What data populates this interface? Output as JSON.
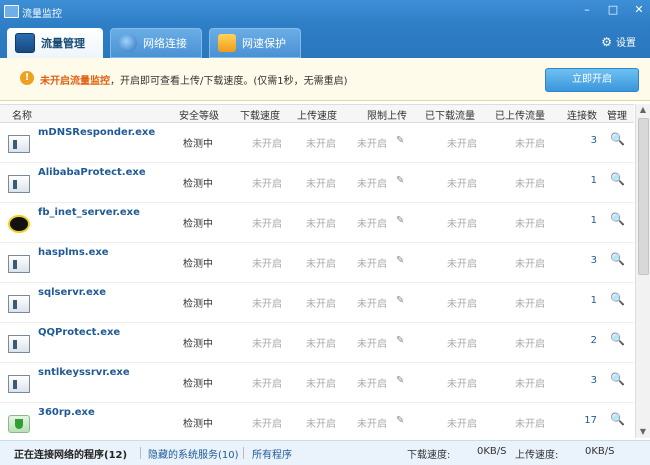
{
  "window": {
    "title": "流量监控",
    "min": "–",
    "max": "□",
    "close": "✕"
  },
  "tabs": [
    {
      "label": "流量管理",
      "active": true
    },
    {
      "label": "网络连接",
      "active": false
    },
    {
      "label": "网速保护",
      "active": false
    }
  ],
  "settings_label": "设置",
  "notice": {
    "icon": "!",
    "highlight": "未开启流量监控",
    "text": "，开启即可查看上传/下载速度。(仅需1秒，无需重启)",
    "button": "立即开启"
  },
  "columns": {
    "name": "名称",
    "security": "安全等级",
    "download_speed": "下载速度",
    "upload_speed": "上传速度",
    "upload_limit": "限制上传",
    "downloaded": "已下载流量",
    "uploaded": "已上传流量",
    "connections": "连接数",
    "manage": "管理"
  },
  "rows": [
    {
      "name": "mDNSResponder.exe",
      "icon": "program-icon",
      "security": "检测中",
      "download": "未开启",
      "upload": "未开启",
      "limit": "未开启",
      "downloaded": "未开启",
      "uploaded": "未开启",
      "connections": "3"
    },
    {
      "name": "AlibabaProtect.exe",
      "icon": "program-icon",
      "security": "检测中",
      "download": "未开启",
      "upload": "未开启",
      "limit": "未开启",
      "downloaded": "未开启",
      "uploaded": "未开启",
      "connections": "1"
    },
    {
      "name": "fb_inet_server.exe",
      "icon": "firebird-icon",
      "security": "检测中",
      "download": "未开启",
      "upload": "未开启",
      "limit": "未开启",
      "downloaded": "未开启",
      "uploaded": "未开启",
      "connections": "1"
    },
    {
      "name": "hasplms.exe",
      "icon": "program-icon",
      "security": "检测中",
      "download": "未开启",
      "upload": "未开启",
      "limit": "未开启",
      "downloaded": "未开启",
      "uploaded": "未开启",
      "connections": "3"
    },
    {
      "name": "sqlservr.exe",
      "icon": "program-icon",
      "security": "检测中",
      "download": "未开启",
      "upload": "未开启",
      "limit": "未开启",
      "downloaded": "未开启",
      "uploaded": "未开启",
      "connections": "1"
    },
    {
      "name": "QQProtect.exe",
      "icon": "program-icon",
      "security": "检测中",
      "download": "未开启",
      "upload": "未开启",
      "limit": "未开启",
      "downloaded": "未开启",
      "uploaded": "未开启",
      "connections": "2"
    },
    {
      "name": "sntlkeyssrvr.exe",
      "icon": "program-icon",
      "security": "检测中",
      "download": "未开启",
      "upload": "未开启",
      "limit": "未开启",
      "downloaded": "未开启",
      "uploaded": "未开启",
      "connections": "3"
    },
    {
      "name": "360rp.exe",
      "icon": "shield-program-icon",
      "security": "检测中",
      "download": "未开启",
      "upload": "未开启",
      "limit": "未开启",
      "downloaded": "未开启",
      "uploaded": "未开启",
      "connections": "17"
    }
  ],
  "status": {
    "connecting": "正在连接网络的程序(12)",
    "hidden": "隐藏的系统服务(10)",
    "all": "所有程序",
    "dl_label": "下载速度:",
    "dl_value": "0KB/S",
    "ul_label": "上传速度:",
    "ul_value": "0KB/S"
  },
  "colors": {
    "titlebar": "#2f7fc7",
    "accent": "#1f5a96",
    "warning": "#e06010",
    "button": "#3a96dc"
  }
}
